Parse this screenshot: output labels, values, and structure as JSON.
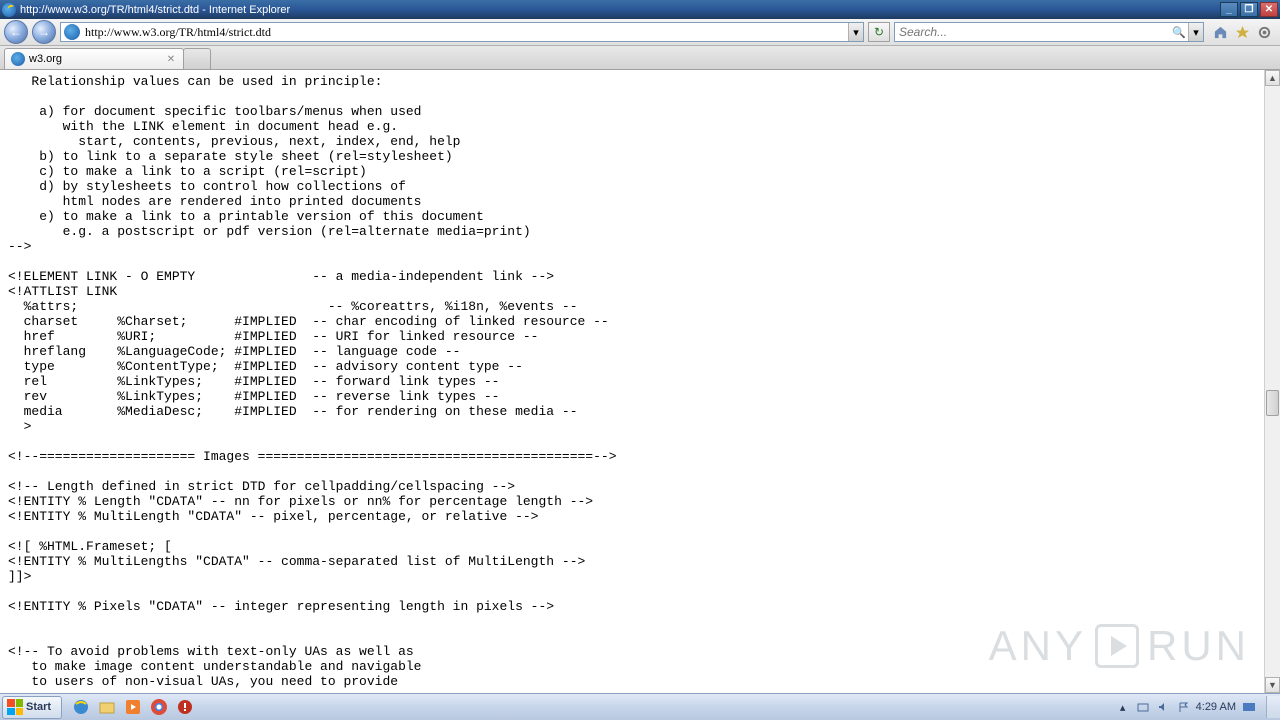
{
  "titlebar": {
    "text": "http://www.w3.org/TR/html4/strict.dtd - Internet Explorer"
  },
  "address": {
    "url": "http://www.w3.org/TR/html4/strict.dtd"
  },
  "search": {
    "placeholder": "Search..."
  },
  "tab": {
    "label": "w3.org"
  },
  "content": "   Relationship values can be used in principle:\n\n    a) for document specific toolbars/menus when used\n       with the LINK element in document head e.g.\n         start, contents, previous, next, index, end, help\n    b) to link to a separate style sheet (rel=stylesheet)\n    c) to make a link to a script (rel=script)\n    d) by stylesheets to control how collections of\n       html nodes are rendered into printed documents\n    e) to make a link to a printable version of this document\n       e.g. a postscript or pdf version (rel=alternate media=print)\n-->\n\n<!ELEMENT LINK - O EMPTY               -- a media-independent link -->\n<!ATTLIST LINK\n  %attrs;                                -- %coreattrs, %i18n, %events --\n  charset     %Charset;      #IMPLIED  -- char encoding of linked resource --\n  href        %URI;          #IMPLIED  -- URI for linked resource --\n  hreflang    %LanguageCode; #IMPLIED  -- language code --\n  type        %ContentType;  #IMPLIED  -- advisory content type --\n  rel         %LinkTypes;    #IMPLIED  -- forward link types --\n  rev         %LinkTypes;    #IMPLIED  -- reverse link types --\n  media       %MediaDesc;    #IMPLIED  -- for rendering on these media --\n  >\n\n<!--==================== Images ===========================================-->\n\n<!-- Length defined in strict DTD for cellpadding/cellspacing -->\n<!ENTITY % Length \"CDATA\" -- nn for pixels or nn% for percentage length -->\n<!ENTITY % MultiLength \"CDATA\" -- pixel, percentage, or relative -->\n\n<![ %HTML.Frameset; [\n<!ENTITY % MultiLengths \"CDATA\" -- comma-separated list of MultiLength -->\n]]>\n\n<!ENTITY % Pixels \"CDATA\" -- integer representing length in pixels -->\n\n\n<!-- To avoid problems with text-only UAs as well as \n   to make image content understandable and navigable \n   to users of non-visual UAs, you need to provide",
  "taskbar": {
    "start": "Start",
    "clock": "4:29 AM"
  },
  "watermark": {
    "left": "ANY",
    "right": "RUN"
  }
}
